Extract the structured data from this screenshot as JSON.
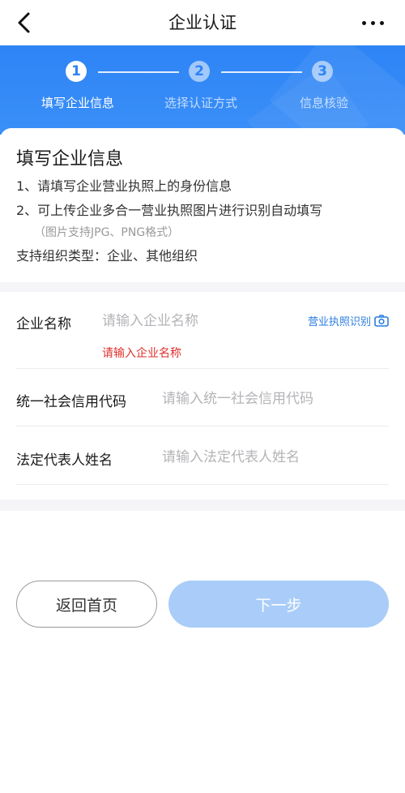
{
  "nav": {
    "title": "企业认证",
    "back_icon": "chevron-left-icon",
    "more_icon": "more-dots-icon"
  },
  "stepper": {
    "steps": [
      {
        "number": "1",
        "label": "填写企业信息",
        "active": true
      },
      {
        "number": "2",
        "label": "选择认证方式",
        "active": false
      },
      {
        "number": "3",
        "label": "信息核验",
        "active": false
      }
    ],
    "accent": "#2e84f5"
  },
  "intro": {
    "title": "填写企业信息",
    "line1": "1、请填写企业营业执照上的身份信息",
    "line2": "2、可上传企业多合一营业执照图片进行识别自动填写",
    "line2_note": "（图片支持JPG、PNG格式）",
    "line3": "支持组织类型：企业、其他组织"
  },
  "form": {
    "company_name": {
      "label": "企业名称",
      "placeholder": "请输入企业名称",
      "value": "",
      "error": "请输入企业名称"
    },
    "ocr_link": {
      "label": "营业执照识别",
      "icon": "camera-icon"
    },
    "credit_code": {
      "label": "统一社会信用代码",
      "placeholder": "请输入统一社会信用代码",
      "value": ""
    },
    "legal_rep": {
      "label": "法定代表人姓名",
      "placeholder": "请输入法定代表人姓名",
      "value": ""
    }
  },
  "actions": {
    "home_label": "返回首页",
    "next_label": "下一步"
  },
  "colors": {
    "primary": "#2e84f5",
    "error": "#e0312c",
    "next_disabled": "#a9cdf8",
    "link": "#2a7de1"
  }
}
